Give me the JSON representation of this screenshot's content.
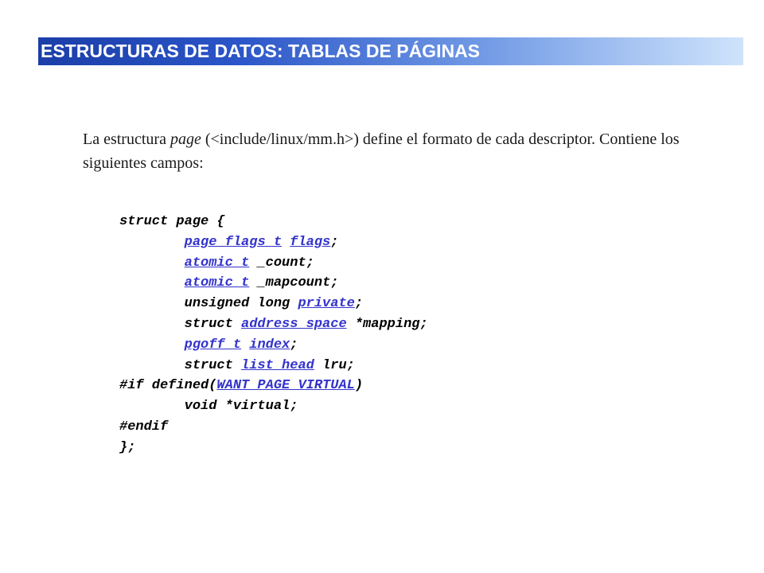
{
  "slide": {
    "title": "ESTRUCTURAS DE DATOS: TABLAS DE PÁGINAS",
    "intro": {
      "part1": "La estructura ",
      "term": "page",
      "part2": " (<include/linux/mm.h>) define el formato de cada descriptor. Contiene los siguientes campos:"
    }
  },
  "code": {
    "lines": [
      [
        {
          "t": "struct page {"
        }
      ],
      [
        {
          "t": "        "
        },
        {
          "t": "page_flags_t",
          "link": true
        },
        {
          "t": " "
        },
        {
          "t": "flags",
          "link": true
        },
        {
          "t": ";"
        }
      ],
      [
        {
          "t": "        "
        },
        {
          "t": "atomic_t",
          "link": true
        },
        {
          "t": " _count;"
        }
      ],
      [
        {
          "t": "        "
        },
        {
          "t": "atomic_t",
          "link": true
        },
        {
          "t": " _mapcount;"
        }
      ],
      [
        {
          "t": "        unsigned long "
        },
        {
          "t": "private",
          "link": true
        },
        {
          "t": ";"
        }
      ],
      [
        {
          "t": "        struct "
        },
        {
          "t": "address_space",
          "link": true
        },
        {
          "t": " *mapping;"
        }
      ],
      [
        {
          "t": "        "
        },
        {
          "t": "pgoff_t",
          "link": true
        },
        {
          "t": " "
        },
        {
          "t": "index",
          "link": true
        },
        {
          "t": ";"
        }
      ],
      [
        {
          "t": "        struct "
        },
        {
          "t": "list_head",
          "link": true
        },
        {
          "t": " lru;"
        }
      ],
      [
        {
          "t": "#if defined("
        },
        {
          "t": "WANT_PAGE_VIRTUAL",
          "link": true
        },
        {
          "t": ")"
        }
      ],
      [
        {
          "t": "        void *virtual;"
        }
      ],
      [
        {
          "t": "#endif"
        }
      ],
      [
        {
          "t": "};"
        }
      ]
    ]
  },
  "colors": {
    "link": "#3333cc",
    "title_bar_start": "#1b3ea8",
    "title_bar_end": "#cfe3fb"
  }
}
